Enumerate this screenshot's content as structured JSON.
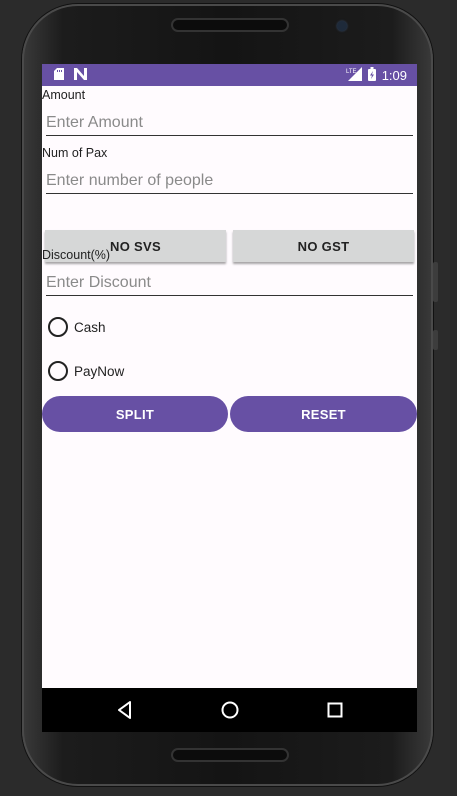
{
  "status_bar": {
    "time": "1:09",
    "left_icons": [
      "sd-card-icon",
      "n-notification-icon"
    ],
    "right_icons": [
      "lte-signal-icon",
      "battery-icon"
    ]
  },
  "form": {
    "amount_label": "Amount",
    "amount_placeholder": "Enter Amount",
    "amount_value": "",
    "pax_label": "Num of Pax",
    "pax_placeholder": "Enter number of people",
    "pax_value": "",
    "no_svs_label": "NO SVS",
    "no_gst_label": "NO GST",
    "discount_label": "Discount(%)",
    "discount_placeholder": "Enter Discount",
    "discount_value": "",
    "payment_options": [
      {
        "label": "Cash",
        "selected": false
      },
      {
        "label": "PayNow",
        "selected": false
      }
    ],
    "split_label": "SPLIT",
    "reset_label": "RESET"
  },
  "colors": {
    "primary": "#6750a4",
    "background": "#fffbfe",
    "gray_button": "#d6d7d7"
  },
  "nav_bar": {
    "icons": [
      "back-icon",
      "home-icon",
      "recents-icon"
    ]
  }
}
